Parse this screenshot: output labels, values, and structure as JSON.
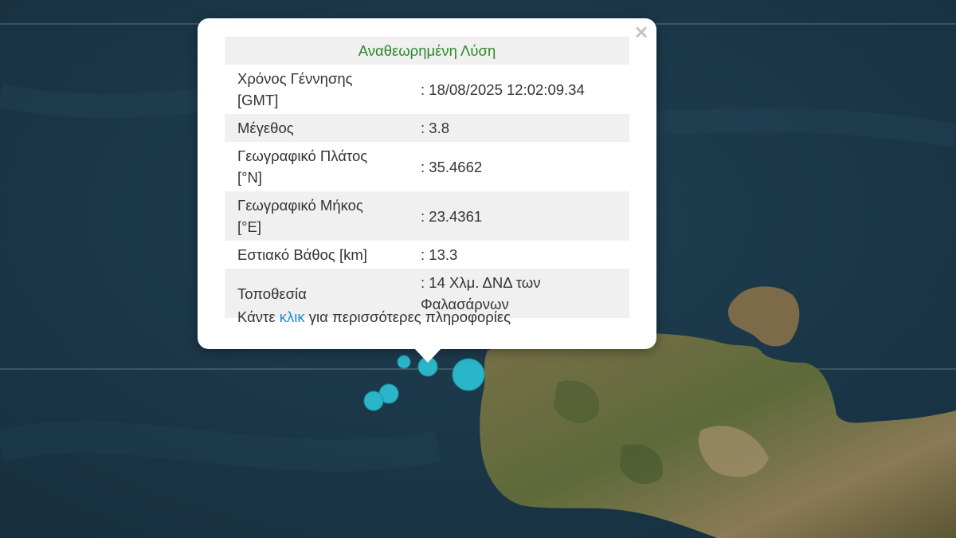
{
  "popup": {
    "title": "Αναθεωρημένη Λύση",
    "close_symbol": "×",
    "rows": [
      {
        "label": "Χρόνος Γέννησης [GMT]",
        "value": ": 18/08/2025 12:02:09.34"
      },
      {
        "label": "Μέγεθος",
        "value": ": 3.8"
      },
      {
        "label": "Γεωγραφικό Πλάτος [°N]",
        "value": ": 35.4662"
      },
      {
        "label": "Γεωγραφικό Μήκος [°E]",
        "value": ": 23.4361"
      },
      {
        "label": "Εστιακό Βάθος [km]",
        "value": ": 13.3"
      },
      {
        "label": "Τοποθεσία",
        "value": ": 14 Χλμ. ΔΝΔ των Φαλασάρνων"
      }
    ],
    "more_prefix": "Κάντε ",
    "more_link": "κλικ",
    "more_suffix": " για περισσότερες πληροφορίες"
  },
  "map": {
    "sea_color": "#1d3a4d",
    "land_color": "#6b6440",
    "marker_color": "#2bb5c8"
  }
}
